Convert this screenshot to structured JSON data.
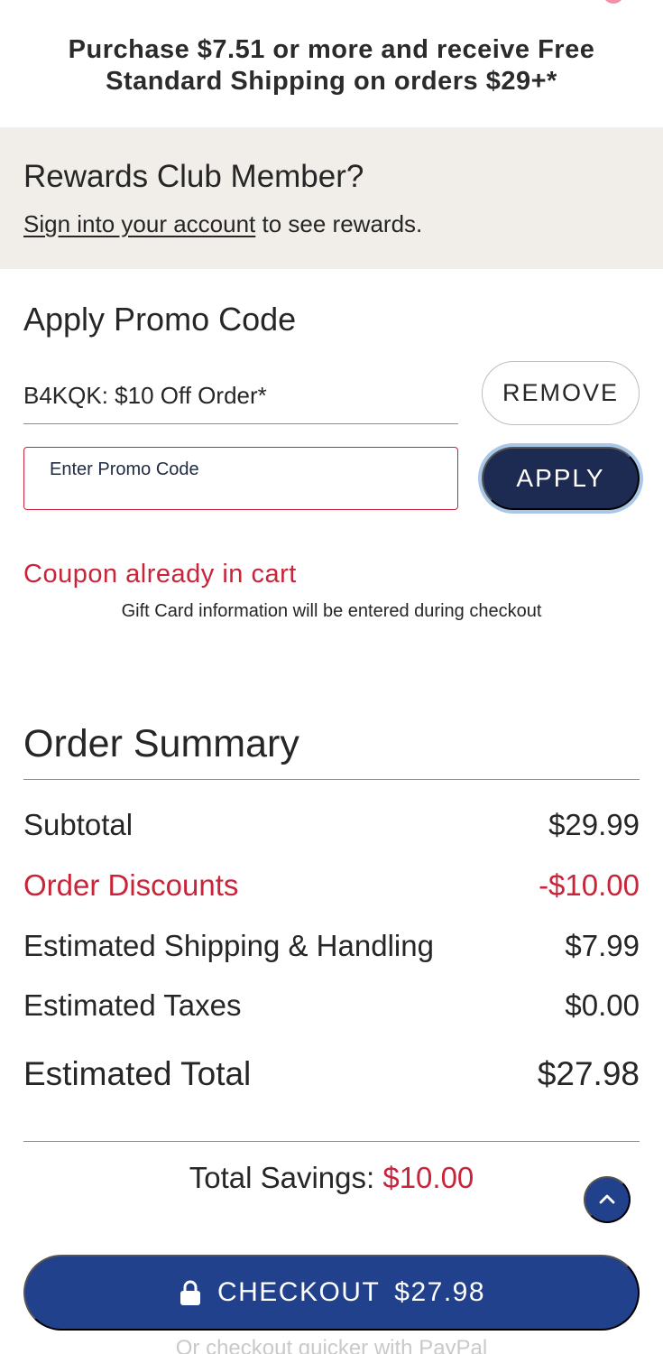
{
  "colors": {
    "accent_red": "#c8243a",
    "navy": "#1d2b52",
    "checkout_blue": "#22418c",
    "rewards_bg": "#f1eee9"
  },
  "shipping_banner": {
    "line1": "Purchase $7.51 or more and receive Free",
    "line2": "Standard Shipping on orders $29+*"
  },
  "rewards": {
    "title": "Rewards Club Member?",
    "link_text": "Sign into your account",
    "suffix_text": " to see rewards."
  },
  "promo": {
    "title": "Apply Promo Code",
    "applied_code": "B4KQK: $10 Off Order*",
    "remove_label": "REMOVE",
    "input_placeholder": "Enter Promo Code",
    "input_value": "",
    "apply_label": "APPLY",
    "error_message": "Coupon already in cart",
    "gift_card_note": "Gift Card information will be entered during checkout"
  },
  "order_summary": {
    "title": "Order Summary",
    "rows": [
      {
        "label": "Subtotal",
        "value": "$29.99"
      },
      {
        "label": "Order Discounts",
        "value": "-$10.00"
      },
      {
        "label": "Estimated Shipping & Handling",
        "value": "$7.99"
      },
      {
        "label": "Estimated Taxes",
        "value": "$0.00"
      }
    ],
    "total_label": "Estimated Total",
    "total_value": "$27.98",
    "savings_label": "Total Savings: ",
    "savings_value": "$10.00"
  },
  "icons": {
    "scroll_top": "chevron-up-icon",
    "checkout_lock": "lock-icon"
  },
  "checkout": {
    "label": "CHECKOUT",
    "amount": "$27.98",
    "paypal_note": "Or checkout quicker with PayPal"
  }
}
